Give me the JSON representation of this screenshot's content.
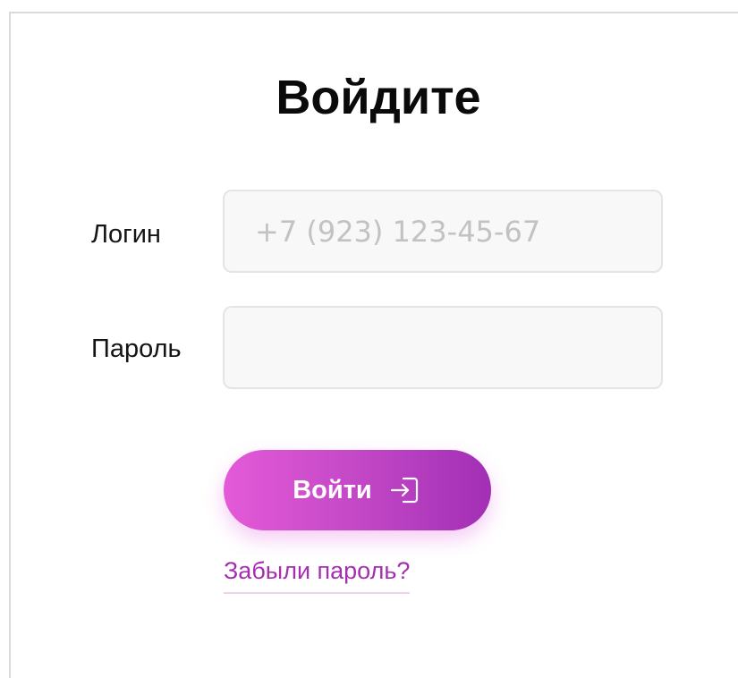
{
  "form": {
    "title": "Войдите",
    "login_label": "Логин",
    "login_placeholder": "+7 (923) 123-45-67",
    "password_label": "Пароль",
    "password_value": "",
    "submit_label": "Войти",
    "submit_icon": "login-arrow-icon",
    "forgot_link": "Забыли пароль?"
  },
  "colors": {
    "accent": "#a62fb1",
    "button_gradient_start": "#e45ad8",
    "button_gradient_end": "#a22fb5",
    "input_bg": "#f8f8f8",
    "placeholder": "#c2c2c2"
  }
}
